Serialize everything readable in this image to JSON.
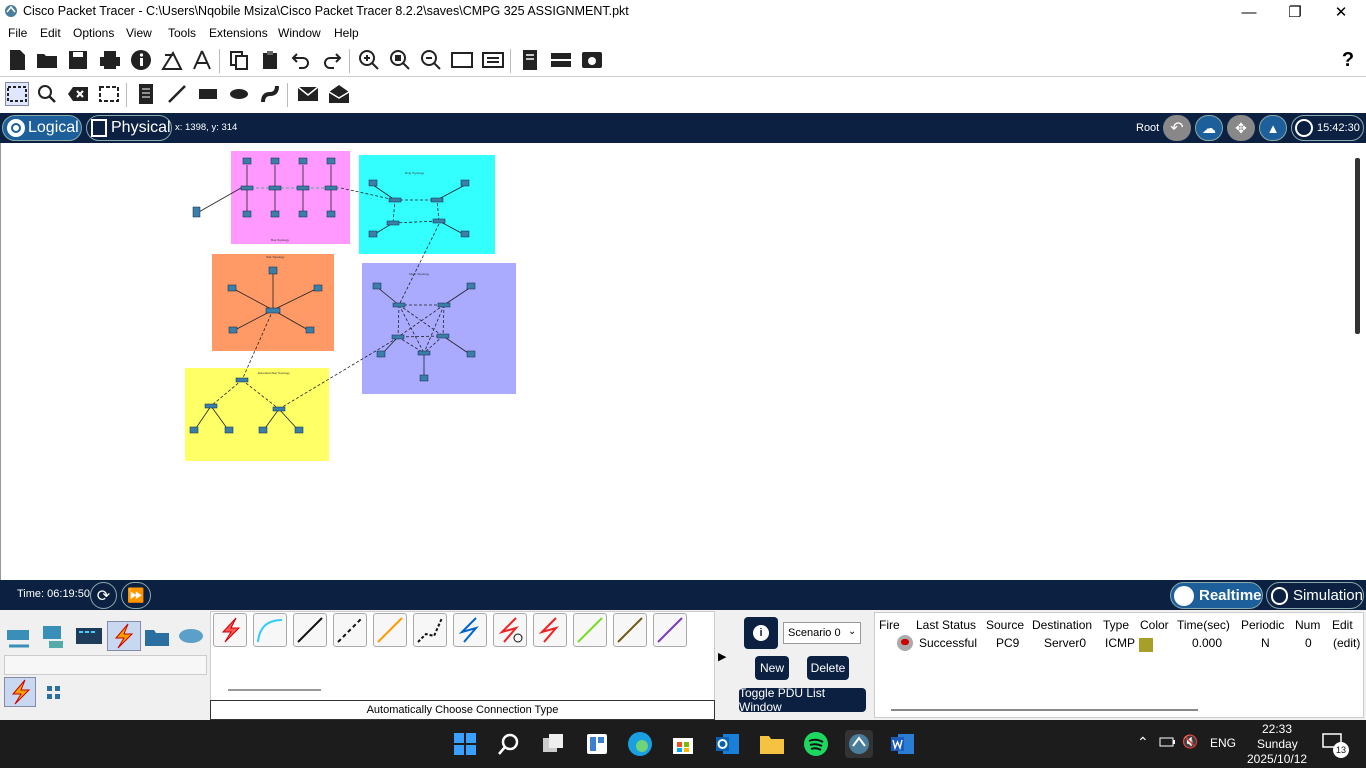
{
  "window": {
    "title": "Cisco Packet Tracer - C:\\Users\\Nqobile Msiza\\Cisco Packet Tracer 8.2.2\\saves\\CMPG 325 ASSIGNMENT.pkt"
  },
  "menu": [
    "File",
    "Edit",
    "Options",
    "View",
    "Tools",
    "Extensions",
    "Window",
    "Help"
  ],
  "nav": {
    "logical": "Logical",
    "physical": "Physical",
    "coords": "x: 1398, y: 314",
    "root": "Root",
    "clock": "15:42:30"
  },
  "topologies": {
    "star": "Star Topology",
    "mesh": "Mesh Topology",
    "ring": "Ring Topology",
    "hybrid": "Extended Star Topology",
    "bus": "Bus Topology"
  },
  "colors": {
    "bus": "#ff99ff",
    "ring": "#33ffff",
    "star": "#ff9966",
    "mesh": "#aaaaff",
    "ext": "#ffff66",
    "navy": "#0c2142"
  },
  "timebar": {
    "time": "Time: 06:19:50",
    "realtime": "Realtime",
    "simulation": "Simulation"
  },
  "connection_label": "Automatically Choose Connection Type",
  "scenario": {
    "select": "Scenario 0",
    "new": "New",
    "delete": "Delete",
    "toggle": "Toggle PDU List Window"
  },
  "pdu": {
    "headers": [
      "Fire",
      "Last Status",
      "Source",
      "Destination",
      "Type",
      "Color",
      "Time(sec)",
      "Periodic",
      "Num",
      "Edit"
    ],
    "row": {
      "status": "Successful",
      "source": "PC9",
      "destination": "Server0",
      "type": "ICMP",
      "color": "#a6a02a",
      "time": "0.000",
      "periodic": "N",
      "num": "0",
      "edit": "(edit)"
    }
  },
  "taskbar": {
    "lang": "ENG",
    "time": "22:33",
    "day": "Sunday",
    "date": "2025/10/12",
    "badge": "13"
  }
}
